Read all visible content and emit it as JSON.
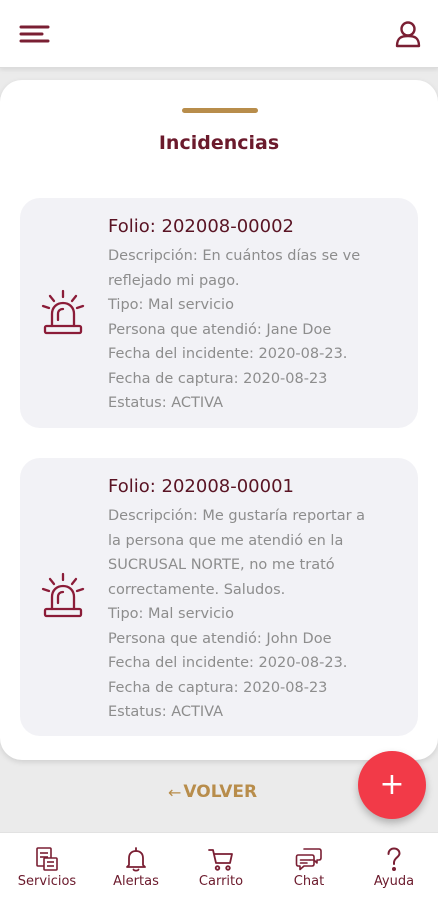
{
  "header": {
    "menu_icon": "hamburger-menu-icon",
    "user_icon": "user-icon",
    "accent_color": "#7a1f33"
  },
  "sheet": {
    "title": "Incidencias",
    "handle_color": "#b88d4b"
  },
  "incidents": [
    {
      "folio": "Folio: 202008-00002",
      "icon": "alarm-siren-icon",
      "description_lines": [
        "Descripción: En cuántos días se ve",
        "reflejado mi pago."
      ],
      "tipo": "Tipo: Mal servicio",
      "persona": "Persona que atendió: Jane Doe",
      "fecha_incidente": "Fecha del incidente: 2020-08-23.",
      "fecha_captura": "Fecha de captura: 2020-08-23",
      "estatus": "Estatus: ACTIVA"
    },
    {
      "folio": "Folio: 202008-00001",
      "icon": "alarm-siren-icon",
      "description_lines": [
        "Descripción: Me gustaría reportar a",
        "la persona que me atendió en la",
        "SUCRUSAL NORTE, no me trató",
        "correctamente. Saludos."
      ],
      "tipo": "Tipo: Mal servicio",
      "persona": "Persona que atendió: John Doe",
      "fecha_incidente": "Fecha del incidente: 2020-08-23.",
      "fecha_captura": "Fecha de captura: 2020-08-23",
      "estatus": "Estatus: ACTIVA"
    }
  ],
  "back": {
    "arrow": "←",
    "label": "VOLVER",
    "color": "#b88d4b"
  },
  "fab": {
    "symbol": "+",
    "color": "#f23a48",
    "icon": "plus-icon"
  },
  "nav": [
    {
      "label": "Servicios",
      "icon": "services-document-icon"
    },
    {
      "label": "Alertas",
      "icon": "bell-icon"
    },
    {
      "label": "Carrito",
      "icon": "cart-icon"
    },
    {
      "label": "Chat",
      "icon": "chat-bubbles-icon"
    },
    {
      "label": "Ayuda",
      "icon": "question-mark-icon"
    }
  ]
}
